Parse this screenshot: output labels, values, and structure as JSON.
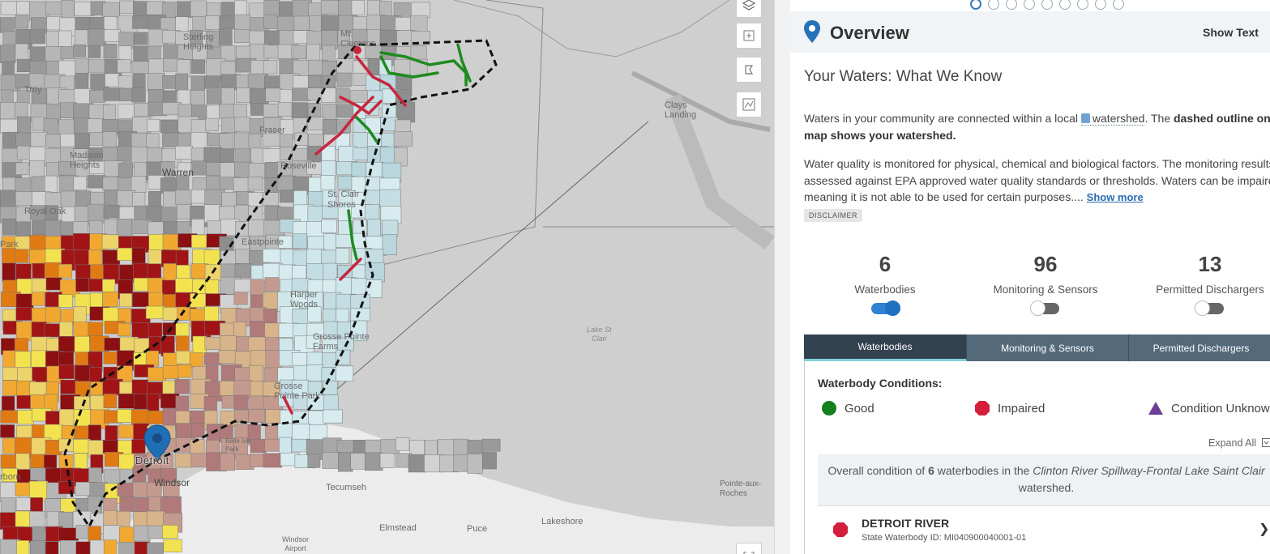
{
  "map": {
    "labels": {
      "sterling_heights": "Sterling\nHeights",
      "mt_clemens": "Mt.\nClemens",
      "troy": "Troy",
      "madison_heights": "Madison\nHeights",
      "warren": "Warren",
      "fraser": "Fraser",
      "roseville": "Roseville",
      "st_clair_shores": "St. Clair\nShores",
      "royal_oak": "Royal Oak",
      "park": "Park",
      "eastpointe": "Eastpointe",
      "harper_woods": "Harper\nWoods",
      "grosse_pointe_farms": "Grosse Pointe\nFarms",
      "grosse_pointe_park": "Grosse\nPointe Park",
      "belle_isle_park": "Belle Isle\nPark",
      "detroit": "Detroit",
      "windsor": "Windsor",
      "tecumseh": "Tecumseh",
      "elmstead": "Elmstead",
      "puce": "Puce",
      "lakeshore": "Lakeshore",
      "windsor_airport": "Windsor\nAirport",
      "clays_landing": "Clays\nLanding",
      "lake_st_clair": "Lake St\nClair",
      "pointe_aux_roches": "Pointe-aux-\nRoches",
      "dearborn_fragment": "rborn"
    }
  },
  "panel": {
    "carousel": {
      "count": 9,
      "active_index": 0
    },
    "header": {
      "title": "Overview",
      "show_text": "Show Text"
    },
    "section_title": "Your Waters: What We Know",
    "intro": {
      "p1_a": "Waters in your community are connected within a local ",
      "p1_link": "watershed",
      "p1_b": ". The ",
      "p1_bold": "dashed outline on the map shows your watershed.",
      "p2": "Water quality is monitored for physical, chemical and biological factors. The monitoring results are assessed against EPA approved water quality standards or thresholds. Waters can be impaired, meaning it is not able to be used for certain purposes....",
      "show_more": "Show more"
    },
    "disclaimer": "DISCLAIMER",
    "stats": [
      {
        "value": "6",
        "label": "Waterbodies",
        "toggle": "on"
      },
      {
        "value": "96",
        "label": "Monitoring & Sensors",
        "toggle": "off"
      },
      {
        "value": "13",
        "label": "Permitted Dischargers",
        "toggle": "off"
      }
    ],
    "tabs": [
      "Waterbodies",
      "Monitoring & Sensors",
      "Permitted Dischargers"
    ],
    "conditions": {
      "title": "Waterbody Conditions:",
      "good": "Good",
      "impaired": "Impaired",
      "unknown": "Condition Unknown",
      "colors": {
        "good": "#15801e",
        "impaired": "#d31f3c",
        "unknown": "#6a3f97"
      }
    },
    "expand_all": "Expand All",
    "summary": {
      "a": "Overall condition of ",
      "count": "6",
      "b": " waterbodies in the ",
      "watershed": "Clinton River Spillway-Frontal Lake Saint Clair",
      "c": " watershed."
    },
    "waterbody": {
      "name": "DETROIT RIVER",
      "id_text": "State Waterbody ID: MI040900040001-01"
    }
  }
}
